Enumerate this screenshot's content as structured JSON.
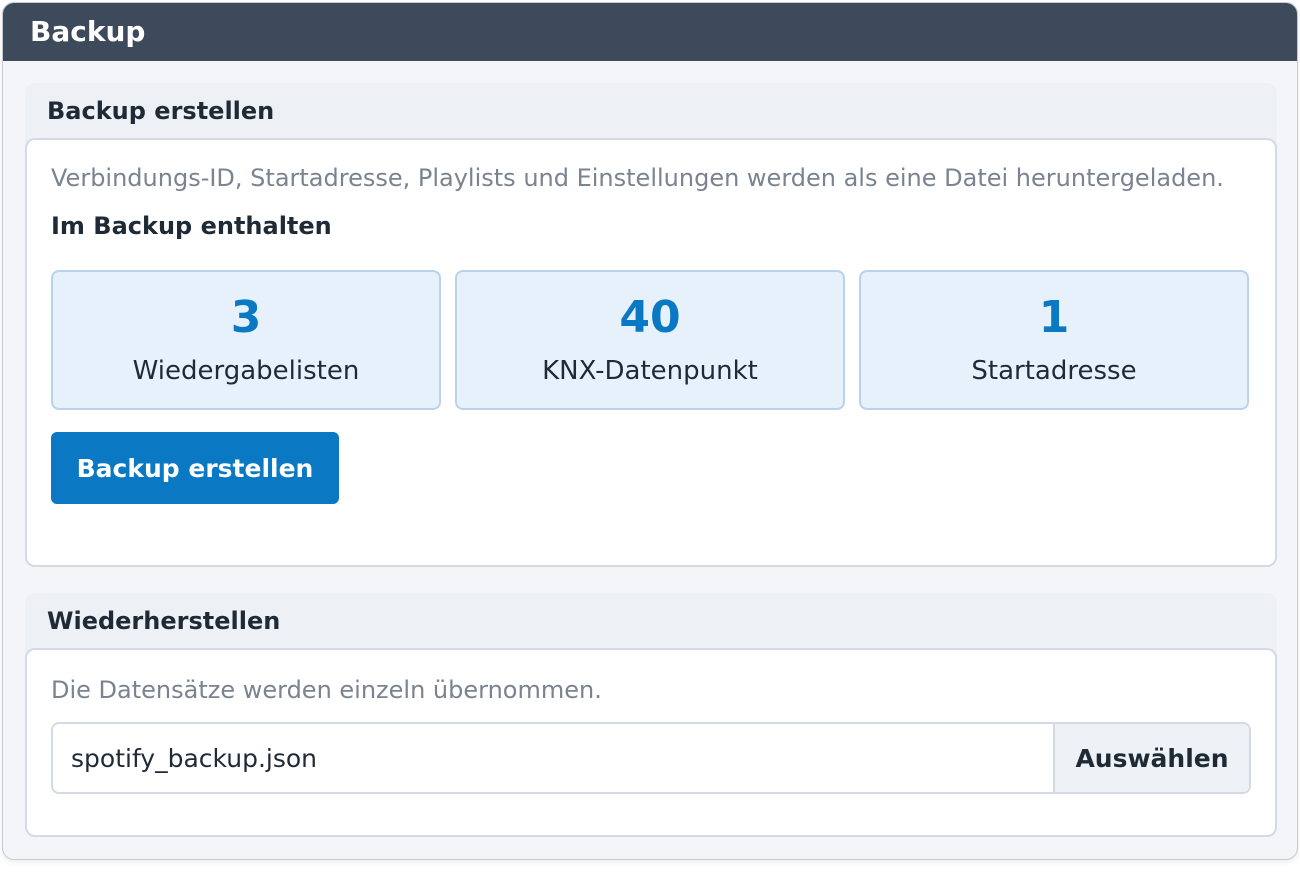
{
  "window": {
    "title": "Backup"
  },
  "create": {
    "header": "Backup erstellen",
    "description": "Verbindungs-ID, Startadresse, Playlists und Einstellungen werden als eine Datei heruntergeladen.",
    "included_title": "Im Backup enthalten",
    "stats": [
      {
        "value": "3",
        "label": "Wiedergabelisten"
      },
      {
        "value": "40",
        "label": "KNX-Datenpunkt"
      },
      {
        "value": "1",
        "label": "Startadresse"
      }
    ],
    "button_label": "Backup erstellen"
  },
  "restore": {
    "header": "Wiederherstellen",
    "description": "Die Datensätze werden einzeln übernommen.",
    "file_value": "spotify_backup.json",
    "choose_label": "Auswählen"
  },
  "colors": {
    "titlebar": "#3d4a5b",
    "accent": "#0a78c2",
    "stat_bg": "#e6f1fb"
  }
}
